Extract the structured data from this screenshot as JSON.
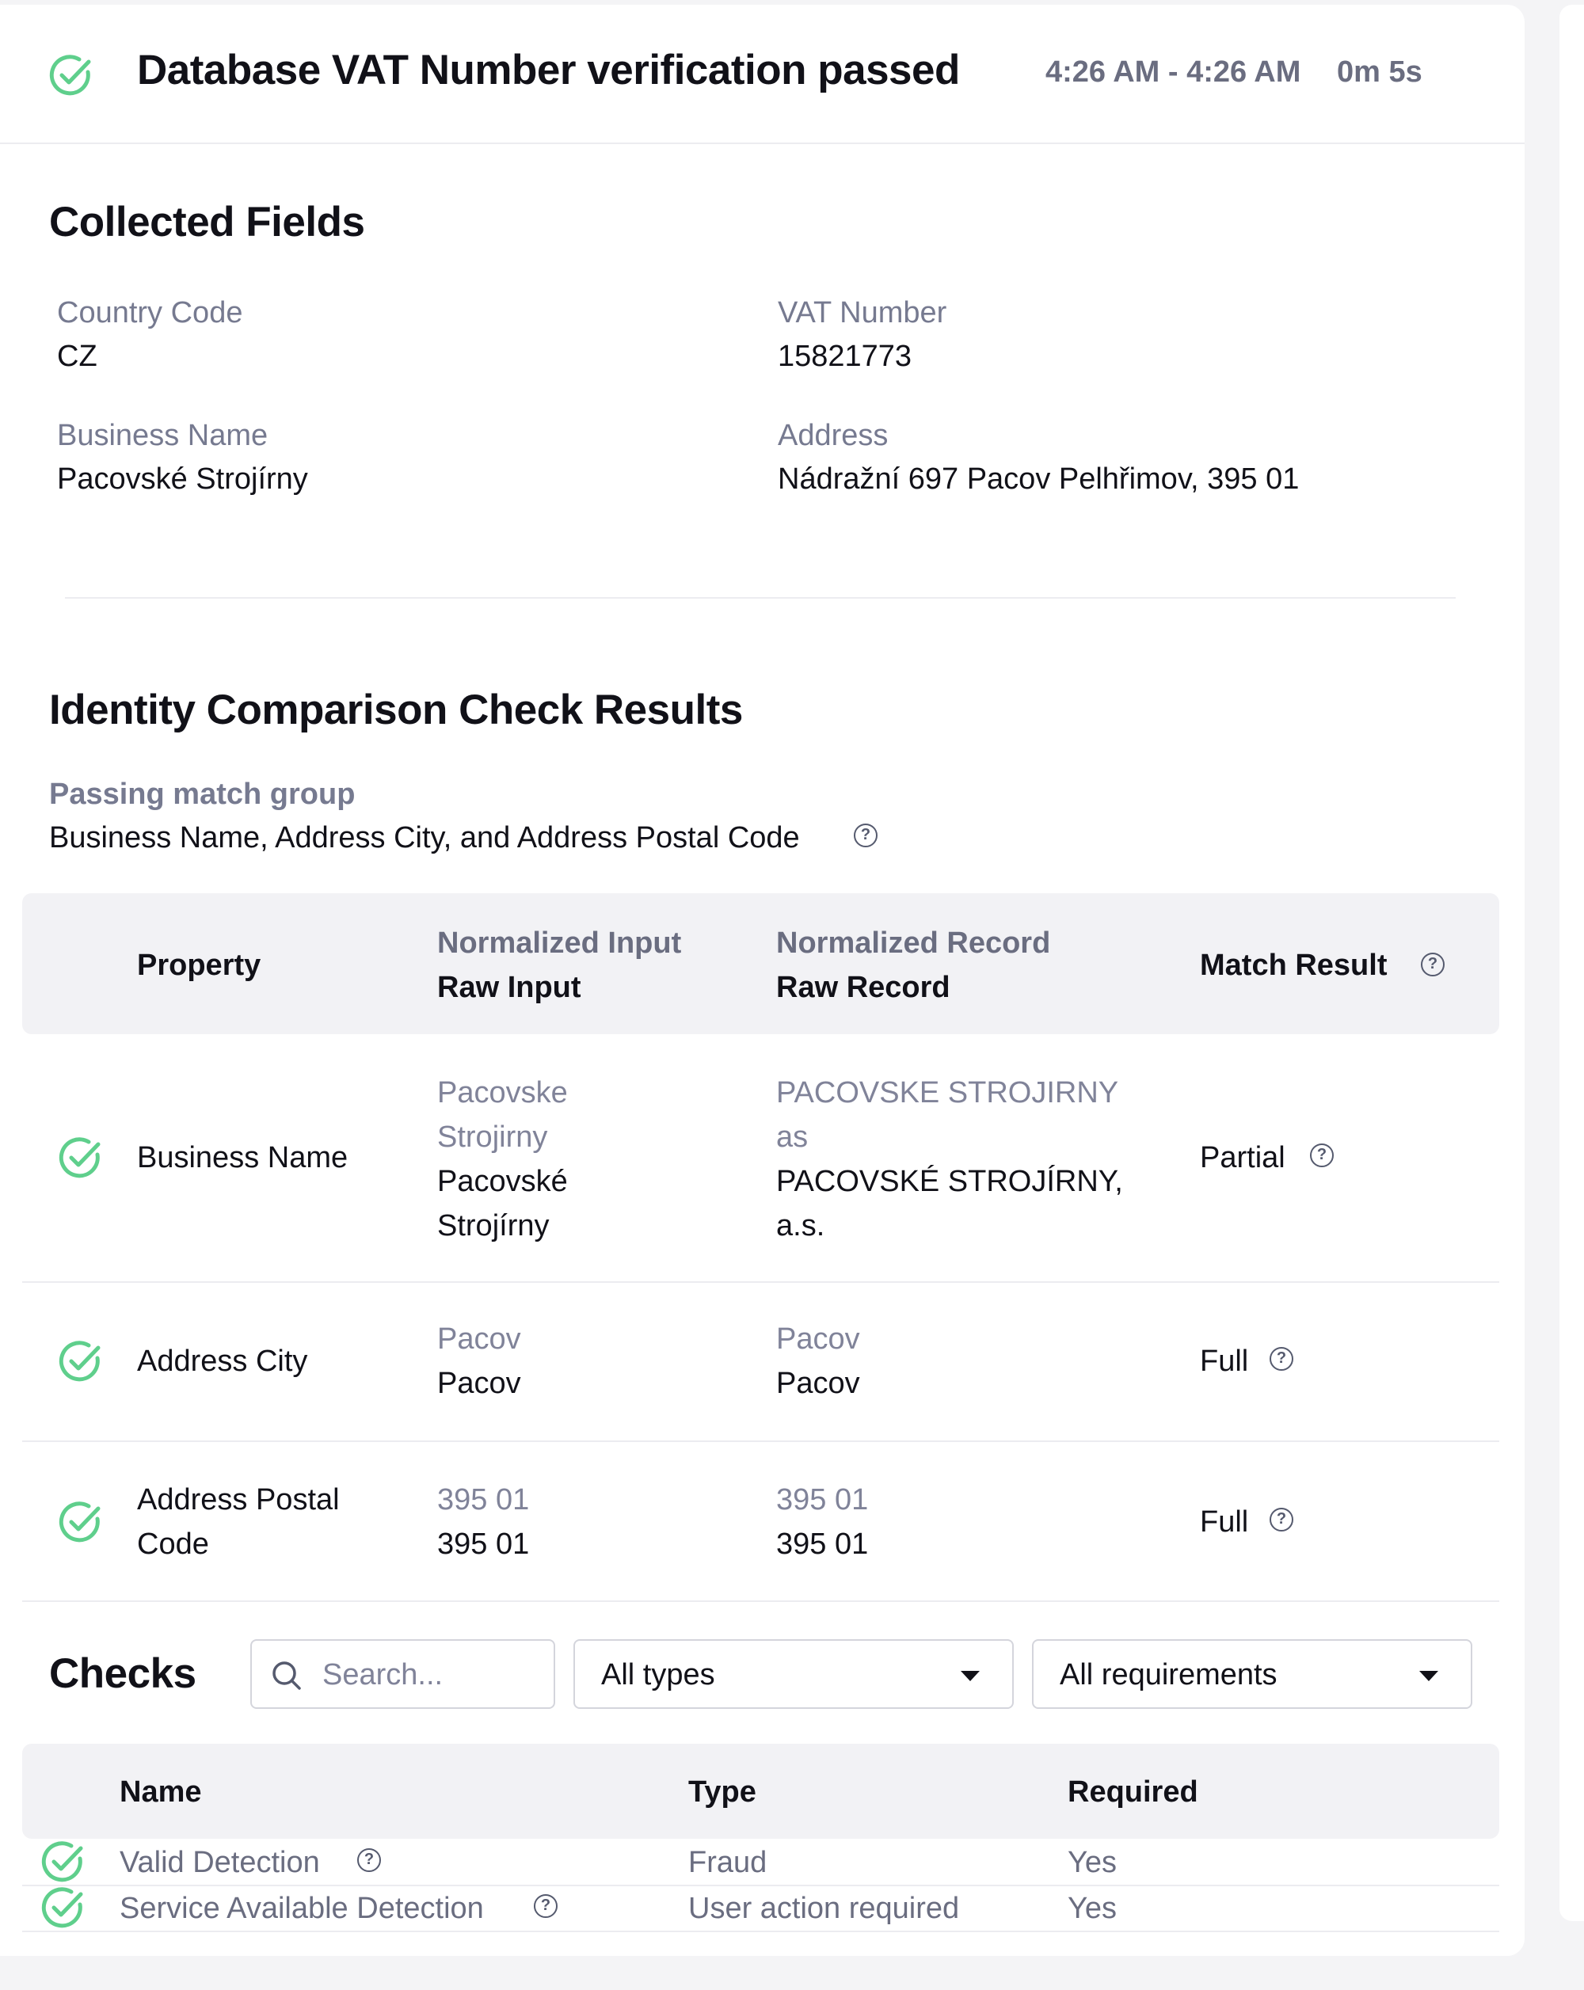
{
  "header": {
    "title": "Database VAT Number verification passed",
    "time_range": "4:26 AM - 4:26 AM",
    "duration": "0m 5s"
  },
  "collected_fields": {
    "title": "Collected Fields",
    "fields": [
      {
        "label": "Country Code",
        "value": "CZ"
      },
      {
        "label": "VAT Number",
        "value": "15821773"
      },
      {
        "label": "Business Name",
        "value": "Pacovské Strojírny"
      },
      {
        "label": "Address",
        "value": "Nádražní 697 Pacov Pelhřimov, 395 01"
      }
    ]
  },
  "comparison": {
    "title": "Identity Comparison Check Results",
    "group_label": "Passing match group",
    "group_value": "Business Name, Address City, and Address Postal Code",
    "columns": {
      "property": "Property",
      "normalized_input": "Normalized Input",
      "raw_input": "Raw Input",
      "normalized_record": "Normalized Record",
      "raw_record": "Raw Record",
      "match_result": "Match Result"
    },
    "rows": [
      {
        "property": "Business Name",
        "normalized_input": "Pacovske Strojirny",
        "raw_input": "Pacovské Strojírny",
        "normalized_record": "PACOVSKE STROJIRNY as",
        "raw_record": "PACOVSKÉ STROJÍRNY, a.s.",
        "match_result": "Partial"
      },
      {
        "property": "Address City",
        "normalized_input": "Pacov",
        "raw_input": "Pacov",
        "normalized_record": "Pacov",
        "raw_record": "Pacov",
        "match_result": "Full"
      },
      {
        "property": "Address Postal Code",
        "normalized_input": "395 01",
        "raw_input": "395 01",
        "normalized_record": "395 01",
        "raw_record": "395 01",
        "match_result": "Full"
      }
    ]
  },
  "checks": {
    "title": "Checks",
    "search_placeholder": "Search...",
    "type_filter": "All types",
    "requirement_filter": "All requirements",
    "columns": {
      "name": "Name",
      "type": "Type",
      "required": "Required"
    },
    "rows": [
      {
        "name": "Valid Detection",
        "type": "Fraud",
        "required": "Yes"
      },
      {
        "name": "Service Available Detection",
        "type": "User action required",
        "required": "Yes"
      }
    ]
  },
  "icons": {
    "status": "check-circle-icon",
    "help": "question-circle-icon",
    "search": "search-icon",
    "dropdown": "caret-down-icon"
  },
  "colors": {
    "success": "#5fcf8c",
    "muted_text": "#767a90",
    "table_header_bg": "#f2f2f5"
  }
}
